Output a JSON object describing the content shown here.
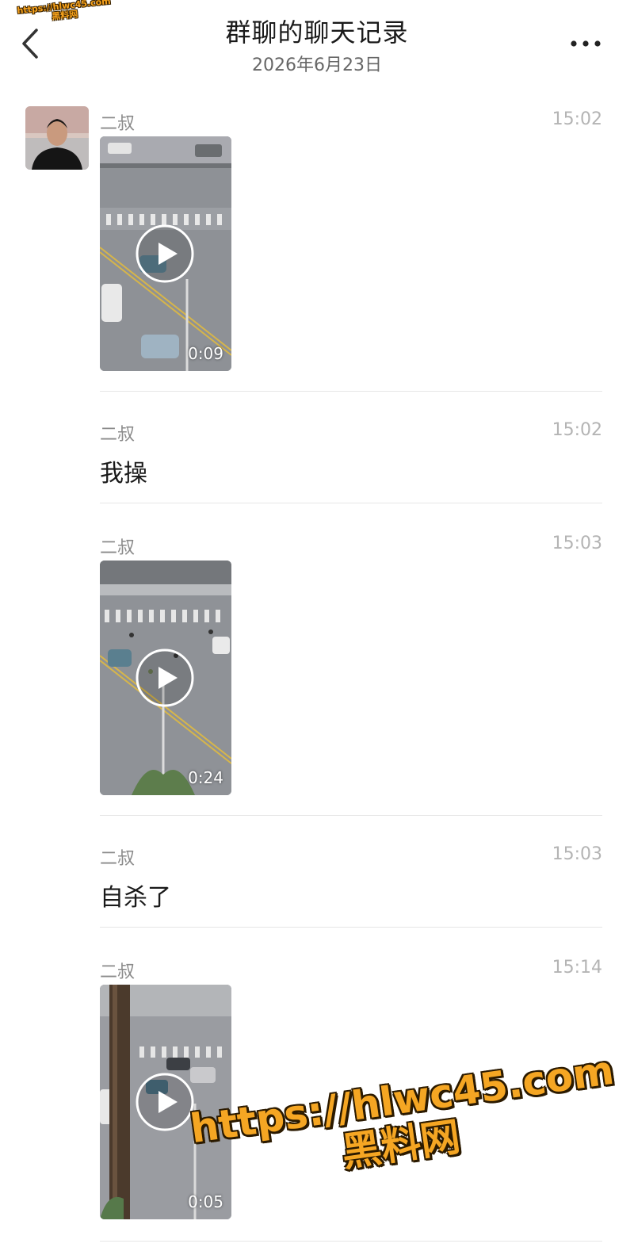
{
  "header": {
    "title": "群聊的聊天记录",
    "date": "2026年6月23日"
  },
  "messages": [
    {
      "sender": "二叔",
      "time": "15:02",
      "type": "video",
      "duration": "0:09"
    },
    {
      "sender": "二叔",
      "time": "15:02",
      "type": "text",
      "text": "我操"
    },
    {
      "sender": "二叔",
      "time": "15:03",
      "type": "video",
      "duration": "0:24"
    },
    {
      "sender": "二叔",
      "time": "15:03",
      "type": "text",
      "text": "自杀了"
    },
    {
      "sender": "二叔",
      "time": "15:14",
      "type": "video",
      "duration": "0:05"
    }
  ],
  "watermark": {
    "small_line1": "https://hlwc45.com",
    "small_line2": "黑料网",
    "big_line1": "https://hlwc45.com",
    "big_line2": "黑料网",
    "color": "#f5a623"
  },
  "icons": {
    "back": "chevron-left-icon",
    "more": "more-dots-icon",
    "play": "play-icon"
  }
}
